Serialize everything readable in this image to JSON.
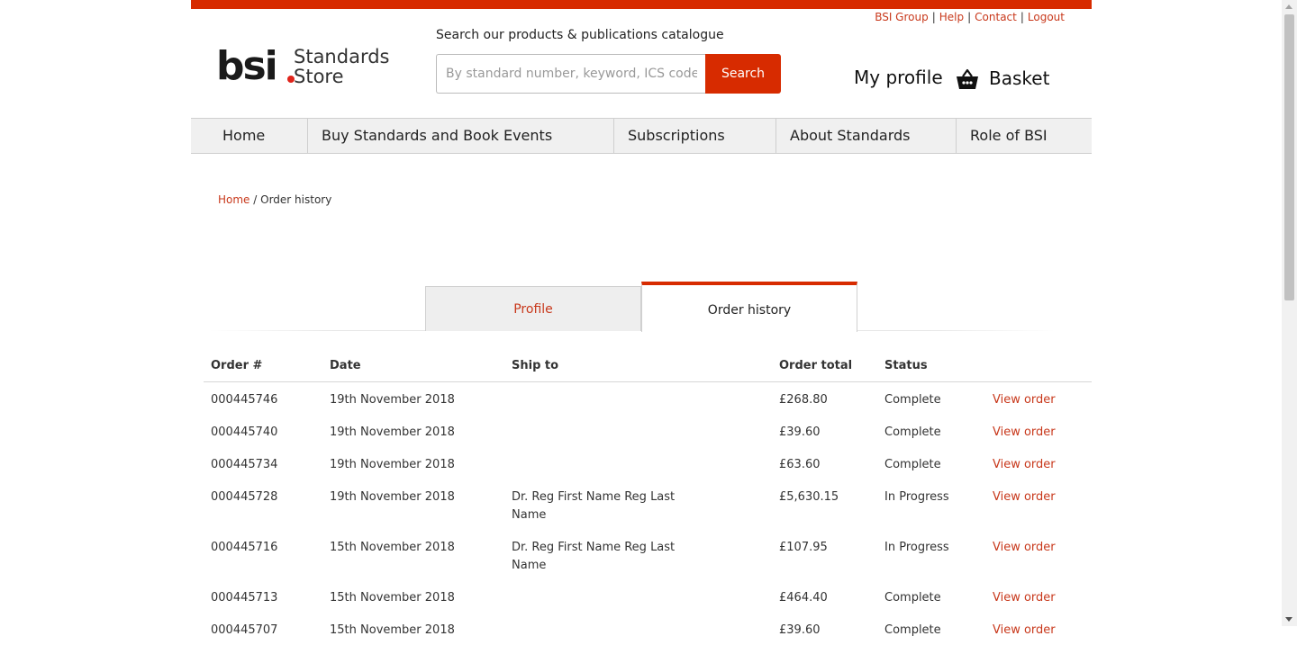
{
  "header": {
    "util_links": [
      "BSI Group",
      "Help",
      "Contact",
      "Logout"
    ],
    "logo": {
      "bsi": "bsi",
      "line1": "Standards",
      "line2": "Store"
    },
    "search": {
      "label": "Search our products & publications catalogue",
      "placeholder": "By standard number, keyword, ICS code, ISBN",
      "button": "Search"
    },
    "my_profile": "My profile",
    "basket": "Basket"
  },
  "nav": [
    "Home",
    "Buy Standards and Book Events",
    "Subscriptions",
    "About Standards",
    "Role of BSI"
  ],
  "breadcrumb": {
    "home": "Home",
    "separator": "/",
    "current": "Order history"
  },
  "tabs": {
    "profile": "Profile",
    "order_history": "Order history"
  },
  "orders": {
    "headers": [
      "Order #",
      "Date",
      "Ship to",
      "Order total",
      "Status"
    ],
    "view_label": "View order",
    "rows": [
      {
        "order": "000445746",
        "date": "19th November 2018",
        "ship_to": "",
        "total": "£268.80",
        "status": "Complete"
      },
      {
        "order": "000445740",
        "date": "19th November 2018",
        "ship_to": "",
        "total": "£39.60",
        "status": "Complete"
      },
      {
        "order": "000445734",
        "date": "19th November 2018",
        "ship_to": "",
        "total": "£63.60",
        "status": "Complete"
      },
      {
        "order": "000445728",
        "date": "19th November 2018",
        "ship_to": "Dr. Reg First Name Reg Last Name",
        "total": "£5,630.15",
        "status": "In Progress"
      },
      {
        "order": "000445716",
        "date": "15th November 2018",
        "ship_to": "Dr. Reg First Name Reg Last Name",
        "total": "£107.95",
        "status": "In Progress"
      },
      {
        "order": "000445713",
        "date": "15th November 2018",
        "ship_to": "",
        "total": "£464.40",
        "status": "Complete"
      },
      {
        "order": "000445707",
        "date": "15th November 2018",
        "ship_to": "",
        "total": "£39.60",
        "status": "Complete"
      }
    ]
  },
  "colors": {
    "accent": "#d72b00",
    "link": "#c8381b",
    "nav_bg": "#f0f0f0"
  },
  "icons": {
    "basket": "basket-icon"
  }
}
